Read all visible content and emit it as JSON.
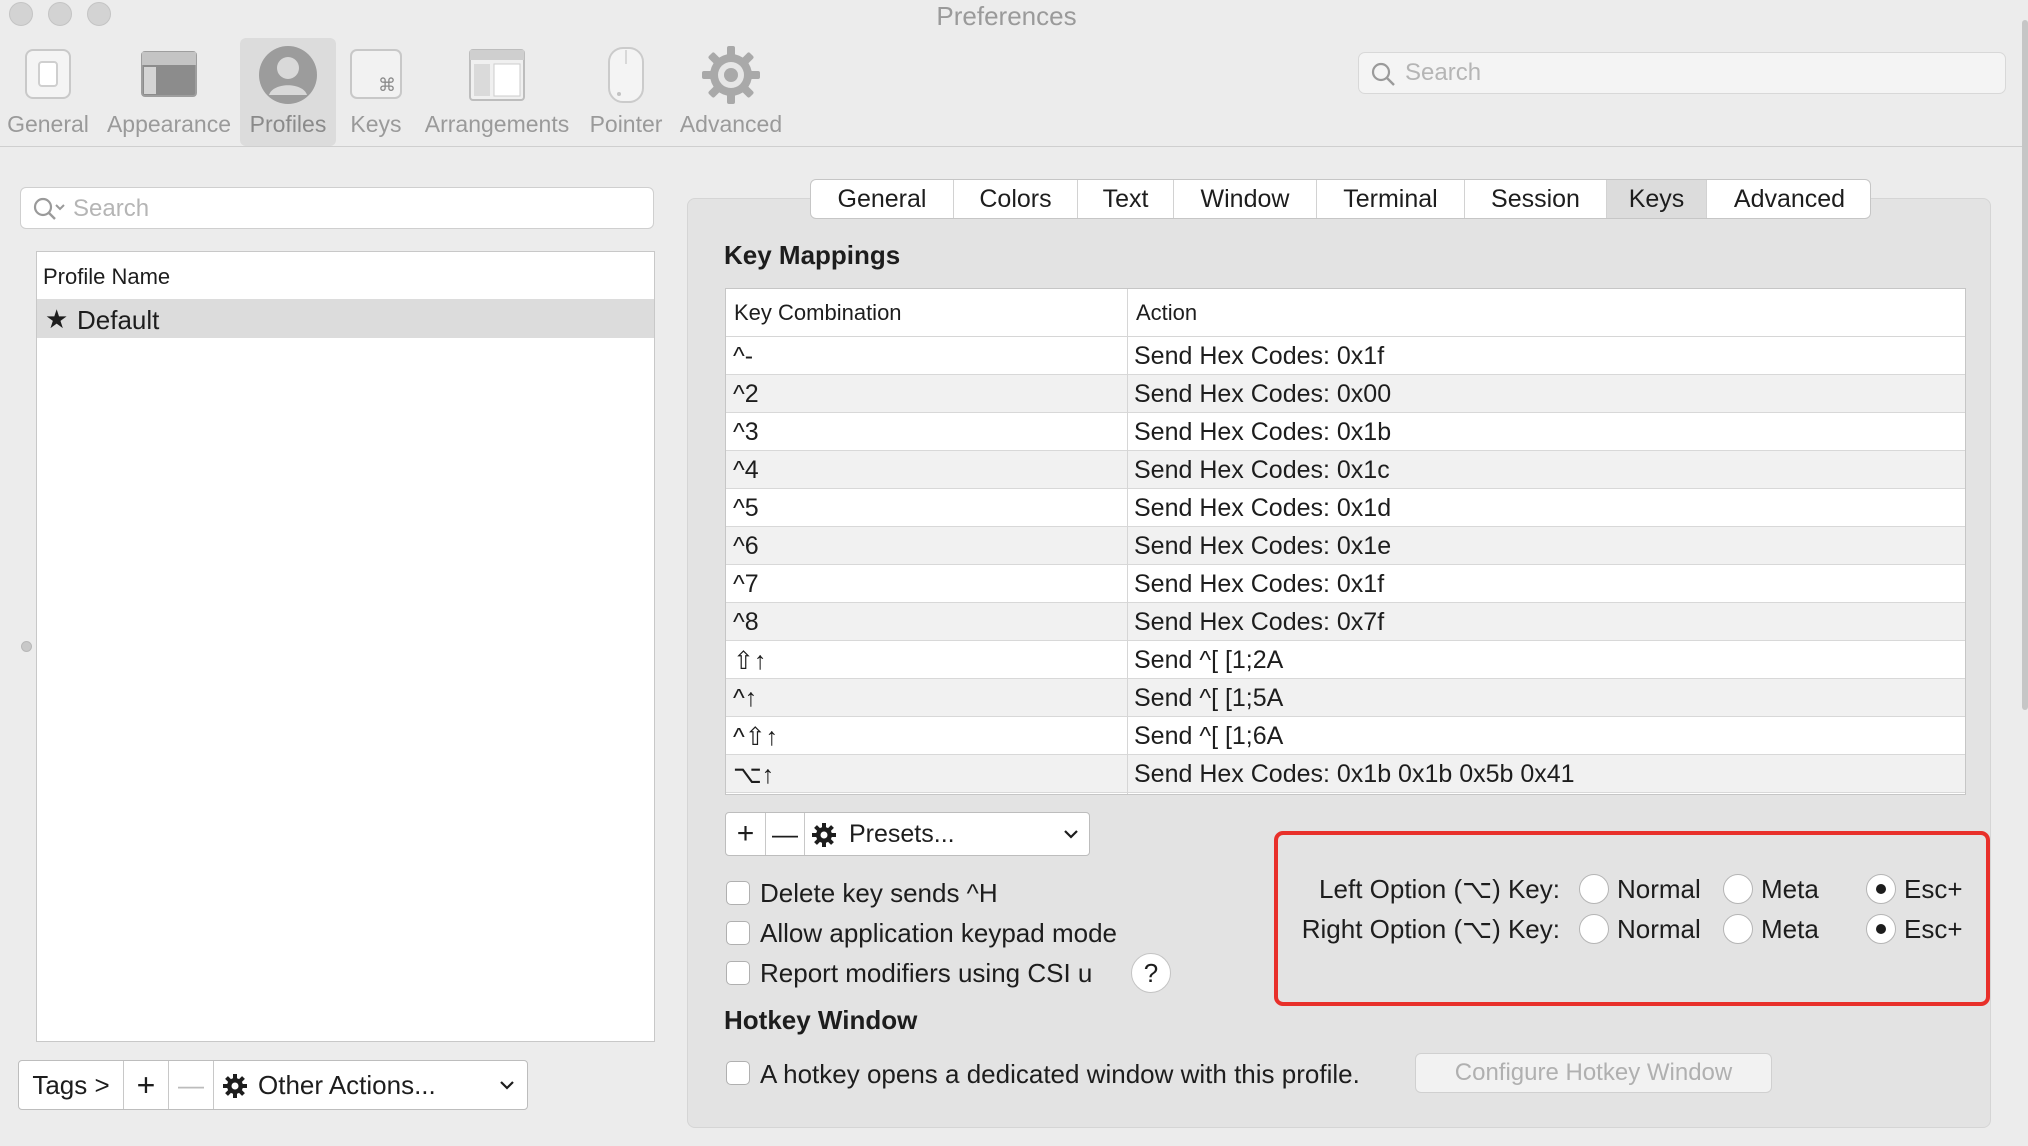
{
  "window": {
    "title": "Preferences"
  },
  "toolbar": {
    "items": [
      {
        "label": "General",
        "icon": "general-switch-icon"
      },
      {
        "label": "Appearance",
        "icon": "appearance-icon"
      },
      {
        "label": "Profiles",
        "icon": "profiles-person-icon",
        "selected": true
      },
      {
        "label": "Keys",
        "icon": "keys-command-icon"
      },
      {
        "label": "Arrangements",
        "icon": "arrangements-icon"
      },
      {
        "label": "Pointer",
        "icon": "mouse-pointer-icon"
      },
      {
        "label": "Advanced",
        "icon": "gear-icon"
      }
    ],
    "search_placeholder": "Search"
  },
  "profiles_panel": {
    "search_placeholder": "Search",
    "column_header": "Profile Name",
    "profiles": [
      {
        "name": "Default",
        "is_default": true,
        "default_marker": "★"
      }
    ],
    "bottom_bar": {
      "tags_label": "Tags >",
      "add_label": "+",
      "remove_label": "—",
      "other_actions_label": "Other Actions..."
    }
  },
  "profile_tabs": {
    "tabs": [
      "General",
      "Colors",
      "Text",
      "Window",
      "Terminal",
      "Session",
      "Keys",
      "Advanced"
    ],
    "selected": "Keys"
  },
  "key_mappings": {
    "section_title": "Key Mappings",
    "columns": [
      "Key Combination",
      "Action"
    ],
    "rows": [
      {
        "key": "^-",
        "action": "Send Hex Codes: 0x1f"
      },
      {
        "key": "^2",
        "action": "Send Hex Codes: 0x00"
      },
      {
        "key": "^3",
        "action": "Send Hex Codes: 0x1b"
      },
      {
        "key": "^4",
        "action": "Send Hex Codes: 0x1c"
      },
      {
        "key": "^5",
        "action": "Send Hex Codes: 0x1d"
      },
      {
        "key": "^6",
        "action": "Send Hex Codes: 0x1e"
      },
      {
        "key": "^7",
        "action": "Send Hex Codes: 0x1f"
      },
      {
        "key": "^8",
        "action": "Send Hex Codes: 0x7f"
      },
      {
        "key": "⇧↑",
        "action": "Send ^[ [1;2A"
      },
      {
        "key": "^↑",
        "action": "Send ^[ [1;5A"
      },
      {
        "key": "^⇧↑",
        "action": "Send ^[ [1;6A"
      },
      {
        "key": "⌥↑",
        "action": "Send Hex Codes: 0x1b 0x1b 0x5b 0x41"
      }
    ],
    "add_label": "+",
    "remove_label": "—",
    "presets_label": "Presets..."
  },
  "options": {
    "delete_sends_h": {
      "label": "Delete key sends ^H",
      "checked": false
    },
    "keypad_mode": {
      "label": "Allow application keypad mode",
      "checked": false
    },
    "csi_u": {
      "label": "Report modifiers using CSI u",
      "checked": false
    },
    "help_label": "?"
  },
  "option_keys": {
    "left": {
      "label": "Left Option (⌥) Key:",
      "selected": "Esc+"
    },
    "right": {
      "label": "Right Option (⌥) Key:",
      "selected": "Esc+"
    },
    "choices": [
      "Normal",
      "Meta",
      "Esc+"
    ],
    "highlight_color": "#e8302a"
  },
  "hotkey": {
    "section_title": "Hotkey Window",
    "checkbox_label": "A hotkey opens a dedicated window with this profile.",
    "checked": false,
    "configure_label": "Configure Hotkey Window"
  }
}
